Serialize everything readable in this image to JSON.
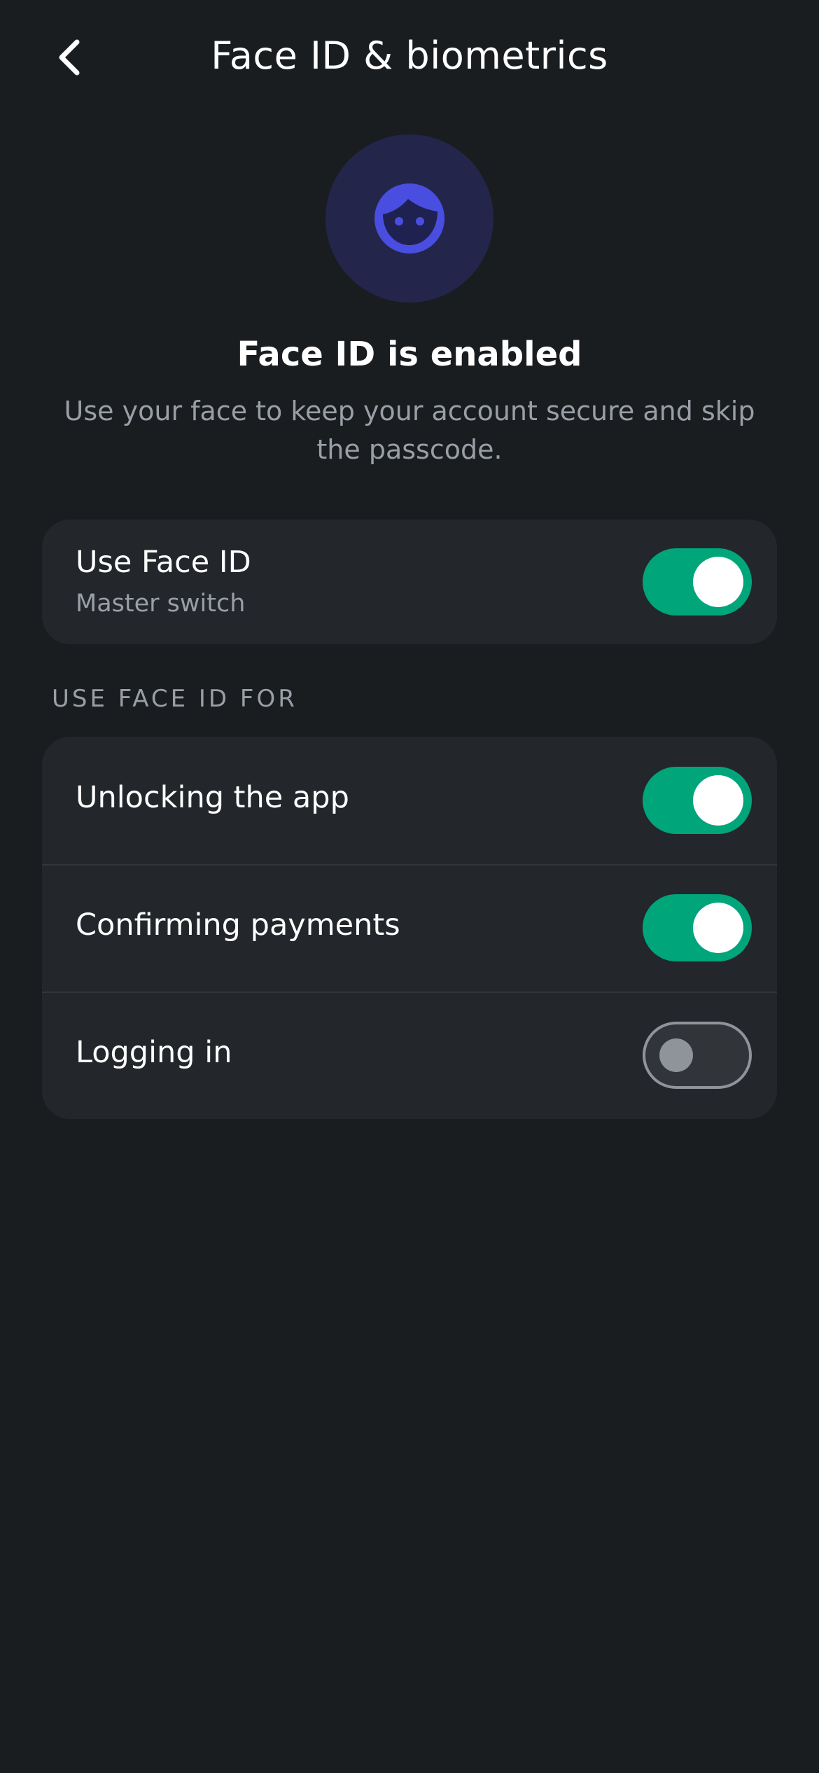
{
  "header": {
    "title": "Face ID & biometrics",
    "back_icon": "chevron-left-icon"
  },
  "hero": {
    "icon": "face-icon",
    "title": "Face ID is enabled",
    "description": "Use your face to keep your account secure and skip the passcode."
  },
  "master": {
    "label": "Use Face ID",
    "sublabel": "Master switch",
    "enabled": true
  },
  "section": {
    "label": "USE FACE ID FOR",
    "items": [
      {
        "label": "Unlocking the app",
        "enabled": true
      },
      {
        "label": "Confirming payments",
        "enabled": true
      },
      {
        "label": "Logging in",
        "enabled": false
      }
    ]
  },
  "colors": {
    "background": "#1a1d20",
    "card": "#23262a",
    "accent_on": "#00a57a",
    "icon_primary": "#4a4ee0",
    "icon_bg": "#23264a",
    "muted_text": "#9a9ea6"
  }
}
